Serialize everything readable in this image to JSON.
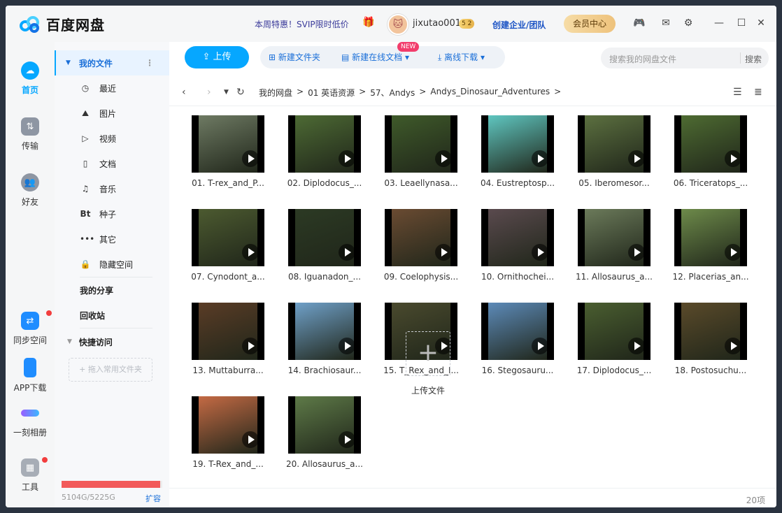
{
  "app": {
    "name": "百度网盘"
  },
  "header": {
    "promo": "本周特惠！SVIP限时低价",
    "username": "jixutao001",
    "badge": "5 2",
    "business": "创建企业/团队",
    "vip_center": "会员中心"
  },
  "rail": {
    "items": [
      {
        "label": "首页"
      },
      {
        "label": "传输"
      },
      {
        "label": "好友"
      },
      {
        "label": "同步空间"
      },
      {
        "label": "APP下载"
      },
      {
        "label": "一刻相册"
      },
      {
        "label": "工具"
      }
    ]
  },
  "nav": {
    "my_files": "我的文件",
    "items": [
      "最近",
      "图片",
      "视频",
      "文档",
      "音乐",
      "种子",
      "其它",
      "隐藏空间"
    ],
    "bt_icon": "Bt",
    "my_share": "我的分享",
    "recycle": "回收站",
    "quick_access": "快捷访问",
    "drag_hint": "+ 拖入常用文件夹",
    "quota": "5104G/5225G",
    "quota_fraction": 0.977,
    "expand": "扩容"
  },
  "toolbar": {
    "upload": "上传",
    "new_folder": "新建文件夹",
    "new_online_doc": "新建在线文档",
    "new_badge": "NEW",
    "offline_download": "离线下载",
    "search_placeholder": "搜索我的网盘文件",
    "search_button": "搜索"
  },
  "breadcrumb": [
    "我的网盘",
    ">",
    "01 英语资源",
    ">",
    "57、Andys",
    ">",
    "Andys_Dinosaur_Adventures",
    ">"
  ],
  "files": [
    {
      "name": "01. T-rex_and_P...",
      "bg": "#6e7a63"
    },
    {
      "name": "02. Diplodocus_...",
      "bg": "#4d6a34"
    },
    {
      "name": "03. Leaellynasa...",
      "bg": "#3f5a2a"
    },
    {
      "name": "04. Eustreptosp...",
      "bg": "#5fc6c0"
    },
    {
      "name": "05. Iberomesor...",
      "bg": "#5c7040"
    },
    {
      "name": "06. Triceratops_...",
      "bg": "#4e6b32"
    },
    {
      "name": "07. Cynodont_a...",
      "bg": "#4c5a30"
    },
    {
      "name": "08. Iguanadon_...",
      "bg": "#2c3a24"
    },
    {
      "name": "09. Coelophysis...",
      "bg": "#6a4b32"
    },
    {
      "name": "10. Ornithochei...",
      "bg": "#5a4a4e"
    },
    {
      "name": "11. Allosaurus_a...",
      "bg": "#6b7a5a"
    },
    {
      "name": "12. Placerias_an...",
      "bg": "#6d8a4a"
    },
    {
      "name": "13. Muttaburra...",
      "bg": "#5a3c26"
    },
    {
      "name": "14. Brachiosaur...",
      "bg": "#6fa0c8"
    },
    {
      "name": "15. T_Rex_and_I...",
      "bg": "#4a4a2e"
    },
    {
      "name": "16. Stegosauru...",
      "bg": "#5c8ab8"
    },
    {
      "name": "17. Diplodocus_...",
      "bg": "#4a5e30"
    },
    {
      "name": "18. Postosuchu...",
      "bg": "#5a4a2a"
    },
    {
      "name": "19. T-Rex_and_...",
      "bg": "#c46a44"
    },
    {
      "name": "20. Allosaurus_a...",
      "bg": "#5e7a48"
    }
  ],
  "upload_tile": "上传文件",
  "footer": {
    "count": "20项"
  },
  "colors": {
    "accent": "#06a7ff",
    "link": "#1a6fd8",
    "quota_bar": "#f25a5a"
  }
}
